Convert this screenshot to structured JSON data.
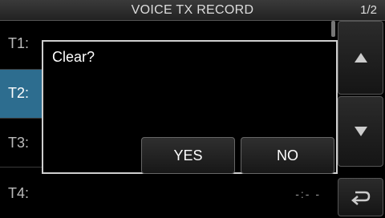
{
  "header": {
    "title": "VOICE TX RECORD",
    "page_indicator": "1/2"
  },
  "list": {
    "rows": [
      {
        "label": "T1:",
        "value": ""
      },
      {
        "label": "T2:",
        "value": ""
      },
      {
        "label": "T3:",
        "value": ""
      },
      {
        "label": "T4:",
        "value": "-:- -"
      }
    ],
    "selected_index": 1
  },
  "side_buttons": {
    "up_icon": "triangle-up-icon",
    "down_icon": "triangle-down-icon",
    "back_icon": "return-arrow-icon"
  },
  "dialog": {
    "message": "Clear?",
    "yes_label": "YES",
    "no_label": "NO"
  },
  "colors": {
    "selected": "#2d6d8f",
    "dialog_border": "#cfcfcf"
  }
}
